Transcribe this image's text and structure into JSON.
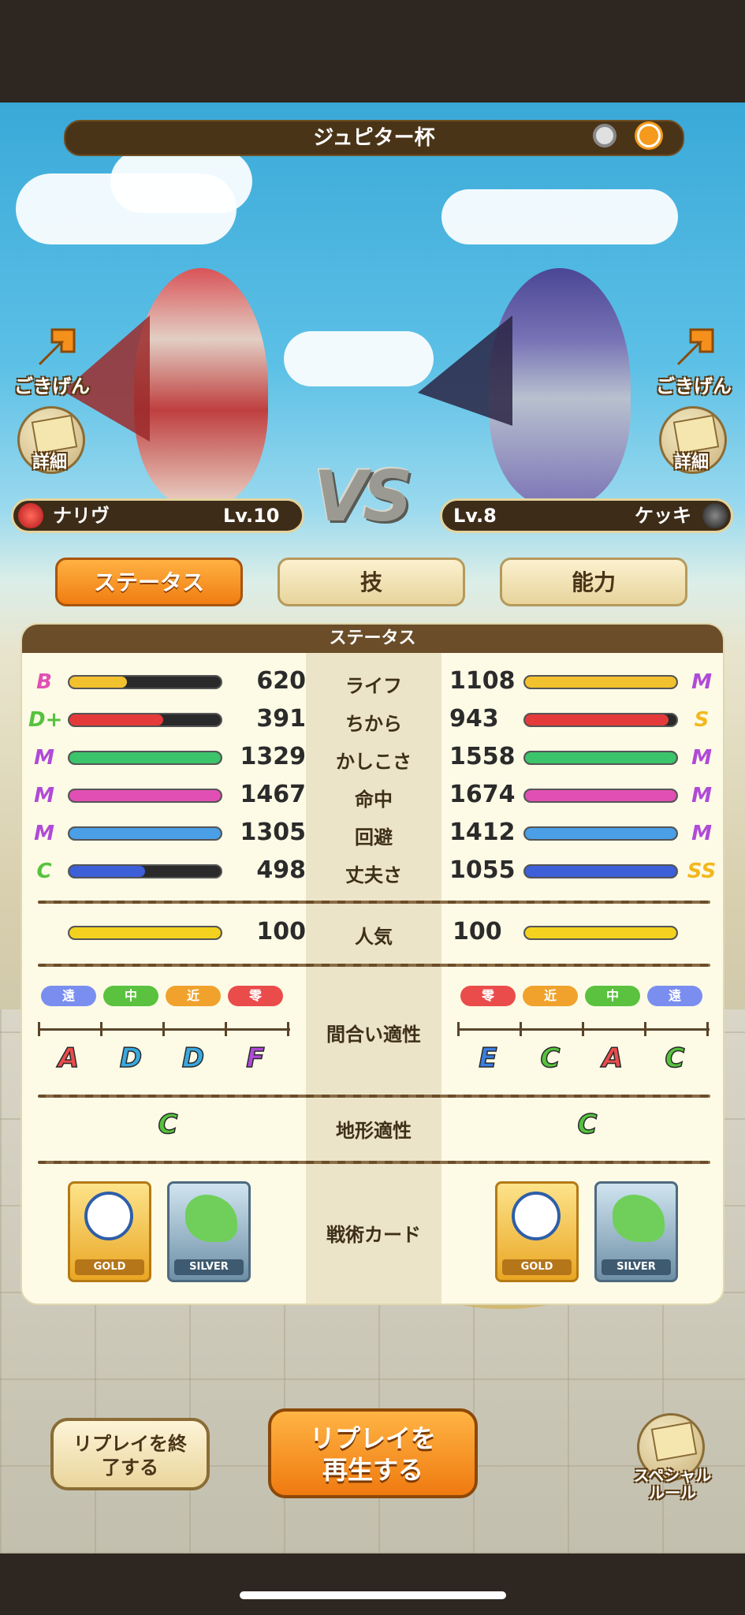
{
  "header": {
    "title": "ジュピター杯",
    "icons": [
      "settings-circle-icon",
      "sun-icon"
    ]
  },
  "left_player": {
    "name": "ナリヴ",
    "level": "Lv.10",
    "mood_label": "ごきげん",
    "detail_label": "詳細",
    "element_icon": "fire-element-icon",
    "accent": "#e6302c"
  },
  "right_player": {
    "name": "ケッキ",
    "level": "Lv.8",
    "mood_label": "ごきげん",
    "detail_label": "詳細",
    "element_icon": "dark-element-icon",
    "accent": "#3b3b3b"
  },
  "vs_label": "VS",
  "tabs": [
    {
      "label": "ステータス",
      "active": true
    },
    {
      "label": "技",
      "active": false
    },
    {
      "label": "能力",
      "active": false
    }
  ],
  "panel": {
    "title": "ステータス",
    "stats": [
      {
        "label": "ライフ",
        "left": {
          "rank": "B",
          "value": "620",
          "fill": 0.38,
          "color": "#f2c12e"
        },
        "right": {
          "rank": "M",
          "value": "1108",
          "fill": 1.0,
          "color": "#f2c12e"
        }
      },
      {
        "label": "ちから",
        "left": {
          "rank": "D+",
          "value": "391",
          "fill": 0.62,
          "color": "#e53a3a"
        },
        "right": {
          "rank": "S",
          "value": "943",
          "fill": 0.95,
          "color": "#e53a3a"
        }
      },
      {
        "label": "かしこさ",
        "left": {
          "rank": "M",
          "value": "1329",
          "fill": 1.0,
          "color": "#3cc46a"
        },
        "right": {
          "rank": "M",
          "value": "1558",
          "fill": 1.0,
          "color": "#3cc46a"
        }
      },
      {
        "label": "命中",
        "left": {
          "rank": "M",
          "value": "1467",
          "fill": 1.0,
          "color": "#e24fb4"
        },
        "right": {
          "rank": "M",
          "value": "1674",
          "fill": 1.0,
          "color": "#e24fb4"
        }
      },
      {
        "label": "回避",
        "left": {
          "rank": "M",
          "value": "1305",
          "fill": 1.0,
          "color": "#4a9fe6"
        },
        "right": {
          "rank": "M",
          "value": "1412",
          "fill": 1.0,
          "color": "#4a9fe6"
        }
      },
      {
        "label": "丈夫さ",
        "left": {
          "rank": "C",
          "value": "498",
          "fill": 0.5,
          "color": "#3d5fd8"
        },
        "right": {
          "rank": "SS",
          "value": "1055",
          "fill": 1.0,
          "color": "#3d5fd8"
        }
      }
    ],
    "popularity": {
      "label": "人気",
      "left": "100",
      "right": "100",
      "left_fill": 1.0,
      "right_fill": 1.0,
      "color": "#f2d21e"
    },
    "range_aptitude": {
      "label": "間合い適性",
      "left_ranges": [
        "遠",
        "中",
        "近",
        "零"
      ],
      "left_grades": [
        "A",
        "D",
        "D",
        "F"
      ],
      "right_ranges": [
        "零",
        "近",
        "中",
        "遠"
      ],
      "right_grades": [
        "E",
        "C",
        "A",
        "C"
      ]
    },
    "terrain": {
      "label": "地形適性",
      "left": "C",
      "right": "C"
    },
    "tactics": {
      "label": "戦術カード",
      "cards": [
        "GOLD",
        "SILVER"
      ]
    }
  },
  "buttons": {
    "end_replay": "リプレイを終了する",
    "play_replay": "リプレイを再生する",
    "special_rule": "スペシャルルール"
  }
}
